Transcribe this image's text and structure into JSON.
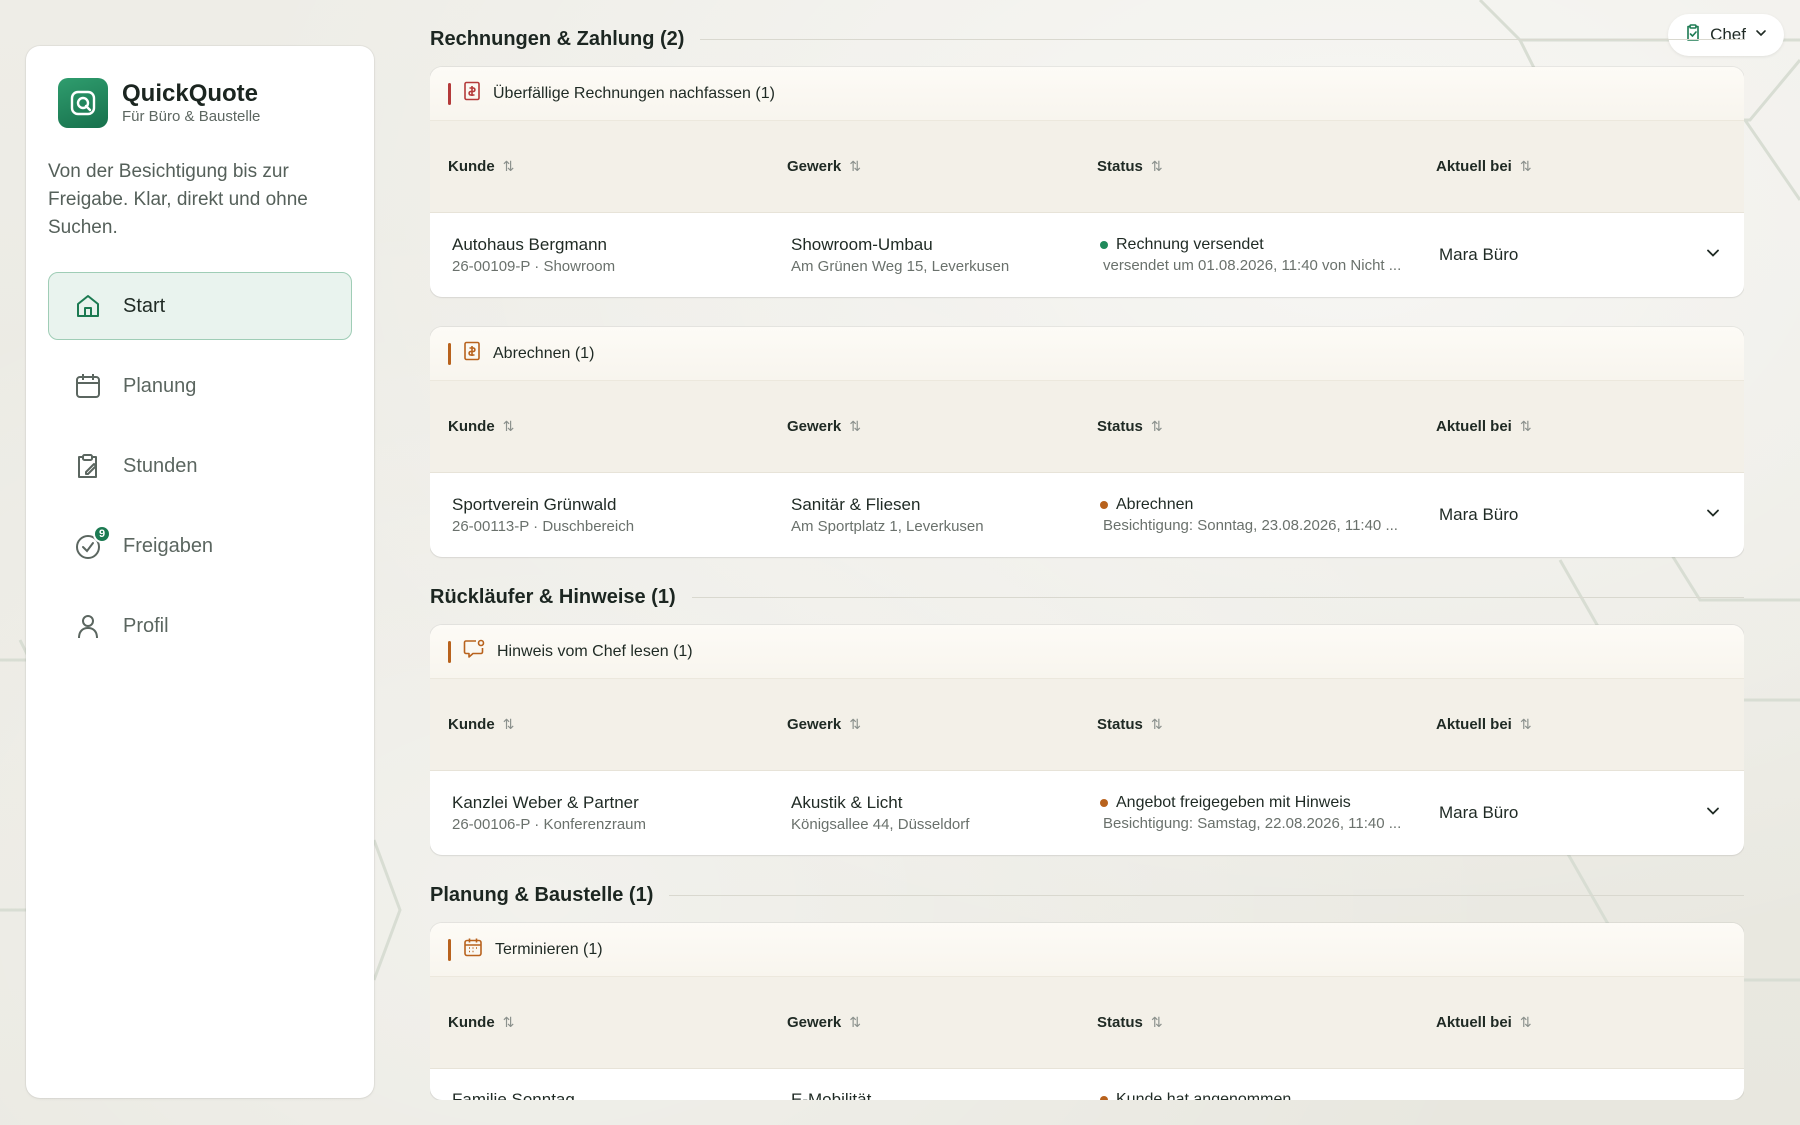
{
  "app": {
    "name": "QuickQuote",
    "subtitle": "Für Büro & Baustelle",
    "tagline": "Von der Besichtigung bis zur Freigabe. Klar, direkt und ohne Suchen."
  },
  "nav": [
    {
      "label": "Start",
      "icon": "home-icon",
      "active": true
    },
    {
      "label": "Planung",
      "icon": "calendar-icon"
    },
    {
      "label": "Stunden",
      "icon": "clipboard-edit-icon"
    },
    {
      "label": "Freigaben",
      "icon": "check-circle-icon",
      "badge": "9"
    },
    {
      "label": "Profil",
      "icon": "user-icon"
    }
  ],
  "role": {
    "label": "Chef",
    "icon": "clipboard-check-icon"
  },
  "columns": {
    "kunde": "Kunde",
    "gewerk": "Gewerk",
    "status": "Status",
    "aktuell": "Aktuell bei"
  },
  "sections": [
    {
      "title": "Rechnungen & Zahlung (2)",
      "groups": [
        {
          "title": "Überfällige Rechnungen nachfassen (1)",
          "icon": "invoice-alert-icon",
          "accent": "#b43a3a",
          "rows": [
            {
              "kunde": "Autohaus Bergmann",
              "kunde_sub": "26-00109-P · Showroom",
              "gewerk": "Showroom-Umbau",
              "gewerk_sub": "Am Grünen Weg 15, Leverkusen",
              "status": "Rechnung versendet",
              "status_color": "#1f8a5b",
              "status_sub": "versendet um 01.08.2026, 11:40 von Nicht ...",
              "aktuell": "Mara Büro"
            }
          ]
        },
        {
          "title": "Abrechnen (1)",
          "icon": "invoice-dollar-icon",
          "accent": "#b8621d",
          "rows": [
            {
              "kunde": "Sportverein Grünwald",
              "kunde_sub": "26-00113-P · Duschbereich",
              "gewerk": "Sanitär & Fliesen",
              "gewerk_sub": "Am Sportplatz 1, Leverkusen",
              "status": "Abrechnen",
              "status_color": "#b8621d",
              "status_sub": "Besichtigung: Sonntag, 23.08.2026, 11:40 ...",
              "aktuell": "Mara Büro"
            }
          ]
        }
      ]
    },
    {
      "title": "Rückläufer & Hinweise (1)",
      "groups": [
        {
          "title": "Hinweis vom Chef lesen (1)",
          "icon": "message-alert-icon",
          "accent": "#b8621d",
          "rows": [
            {
              "kunde": "Kanzlei Weber & Partner",
              "kunde_sub": "26-00106-P · Konferenzraum",
              "gewerk": "Akustik & Licht",
              "gewerk_sub": "Königsallee 44, Düsseldorf",
              "status": "Angebot freigegeben mit Hinweis",
              "status_color": "#b8621d",
              "status_sub": "Besichtigung: Samstag, 22.08.2026, 11:40 ...",
              "aktuell": "Mara Büro"
            }
          ]
        }
      ]
    },
    {
      "title": "Planung & Baustelle (1)",
      "groups": [
        {
          "title": "Terminieren (1)",
          "icon": "calendar-icon",
          "accent": "#b8621d",
          "rows": [
            {
              "kunde": "Familie Sonntag",
              "kunde_sub": "",
              "gewerk": "E-Mobilität",
              "gewerk_sub": "",
              "status": "Kunde hat angenommen",
              "status_color": "#b8621d",
              "status_sub": "",
              "aktuell": ""
            }
          ]
        }
      ]
    }
  ]
}
